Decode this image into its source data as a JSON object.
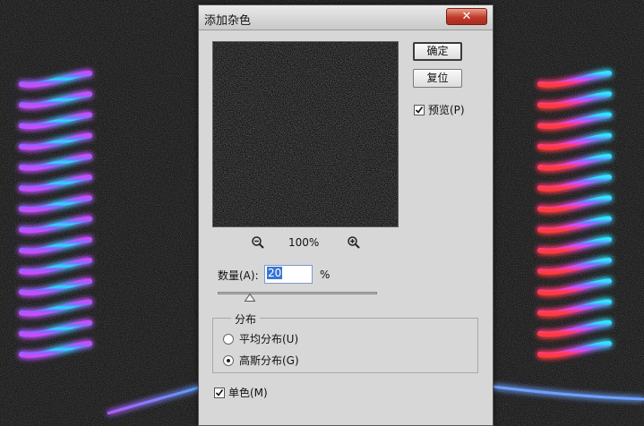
{
  "dialog": {
    "title": "添加杂色",
    "close_symbol": "✕"
  },
  "preview": {
    "zoom_out_icon": "zoom-out-icon",
    "zoom_in_icon": "zoom-in-icon",
    "zoom_level": "100%"
  },
  "buttons": {
    "ok_label": "确定",
    "reset_label": "复位"
  },
  "preview_toggle": {
    "label": "预览(P)",
    "checked": true
  },
  "amount": {
    "label": "数量(A):",
    "value": "20",
    "unit": "%",
    "slider_fraction": 0.2
  },
  "distribution": {
    "legend": "分布",
    "options": [
      {
        "label": "平均分布(U)",
        "selected": false
      },
      {
        "label": "高斯分布(G)",
        "selected": true
      }
    ]
  },
  "monochromatic": {
    "label": "单色(M)",
    "checked": true
  },
  "colors": {
    "dialog_bg": "#d7d7d7",
    "close_red": "#c0392b",
    "selection_blue": "#3875d7"
  }
}
